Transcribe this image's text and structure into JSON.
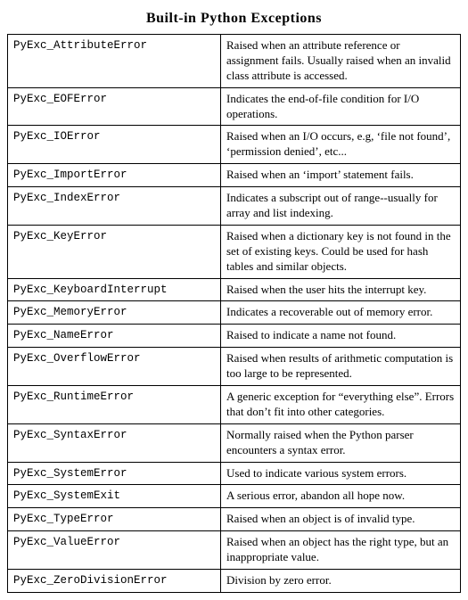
{
  "title": "Built-in Python Exceptions",
  "rows": [
    {
      "name": "PyExc_AttributeError",
      "desc": "Raised when an attribute reference or assignment fails. Usually raised when an invalid class attribute is accessed."
    },
    {
      "name": "PyExc_EOFError",
      "desc": "Indicates the end-of-file condition for I/O operations."
    },
    {
      "name": "PyExc_IOError",
      "desc": "Raised when an I/O occurs, e.g, ‘file not found’, ‘permission denied’, etc..."
    },
    {
      "name": "PyExc_ImportError",
      "desc": "Raised when an ‘import’ statement fails."
    },
    {
      "name": "PyExc_IndexError",
      "desc": "Indicates a subscript out of range--usually for array and list indexing."
    },
    {
      "name": "PyExc_KeyError",
      "desc": "Raised when a dictionary key is not found in the set of existing keys. Could be used for hash tables and similar objects."
    },
    {
      "name": "PyExc_KeyboardInterrupt",
      "desc": "Raised when the user hits the interrupt key."
    },
    {
      "name": "PyExc_MemoryError",
      "desc": "Indicates a recoverable out of memory error."
    },
    {
      "name": "PyExc_NameError",
      "desc": "Raised to indicate a name not found."
    },
    {
      "name": "PyExc_OverflowError",
      "desc": "Raised when results of arithmetic computation is too large to be represented."
    },
    {
      "name": "PyExc_RuntimeError",
      "desc": "A generic exception for “everything else”. Errors that don’t fit into other categories."
    },
    {
      "name": "PyExc_SyntaxError",
      "desc": "Normally raised when the Python parser encounters a syntax error."
    },
    {
      "name": "PyExc_SystemError",
      "desc": "Used to indicate various system errors."
    },
    {
      "name": "PyExc_SystemExit",
      "desc": "A serious error, abandon all hope now."
    },
    {
      "name": "PyExc_TypeError",
      "desc": "Raised when an object is of invalid type."
    },
    {
      "name": "PyExc_ValueError",
      "desc": "Raised when an object has the right type, but an inappropriate value."
    },
    {
      "name": "PyExc_ZeroDivisionError",
      "desc": "Division by zero error."
    }
  ]
}
